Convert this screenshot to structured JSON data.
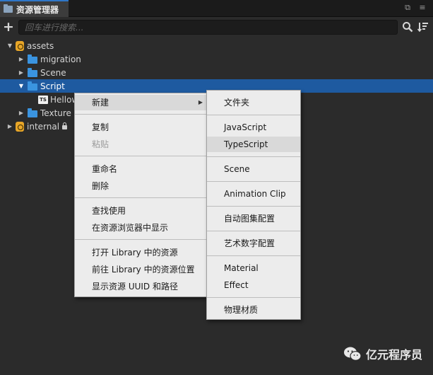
{
  "panel": {
    "tab_title": "资源管理器",
    "search_placeholder": "回车进行搜索..."
  },
  "tree": {
    "assets": "assets",
    "migration": "migration",
    "scene": "Scene",
    "script": "Script",
    "script_child": "Hellow",
    "texture": "Texture",
    "internal": "internal"
  },
  "context_menu": {
    "new": "新建",
    "copy": "复制",
    "paste": "粘贴",
    "rename": "重命名",
    "delete": "删除",
    "find_usage": "查找使用",
    "show_in_browser": "在资源浏览器中显示",
    "open_in_library": "打开 Library 中的资源",
    "goto_library": "前往 Library 中的资源位置",
    "show_uuid": "显示资源 UUID 和路径"
  },
  "submenu": {
    "folder": "文件夹",
    "javascript": "JavaScript",
    "typescript": "TypeScript",
    "scene": "Scene",
    "animation_clip": "Animation Clip",
    "auto_atlas": "自动图集配置",
    "art_number": "艺术数字配置",
    "material": "Material",
    "effect": "Effect",
    "physics_material": "物理材质"
  },
  "watermark": {
    "text": "亿元程序员",
    "icon": "wechat-icon"
  },
  "colors": {
    "selection": "#1e5aa0",
    "folder": "#3a94e0",
    "asset_db": "#e8a628",
    "menu_bg": "#ececec"
  }
}
